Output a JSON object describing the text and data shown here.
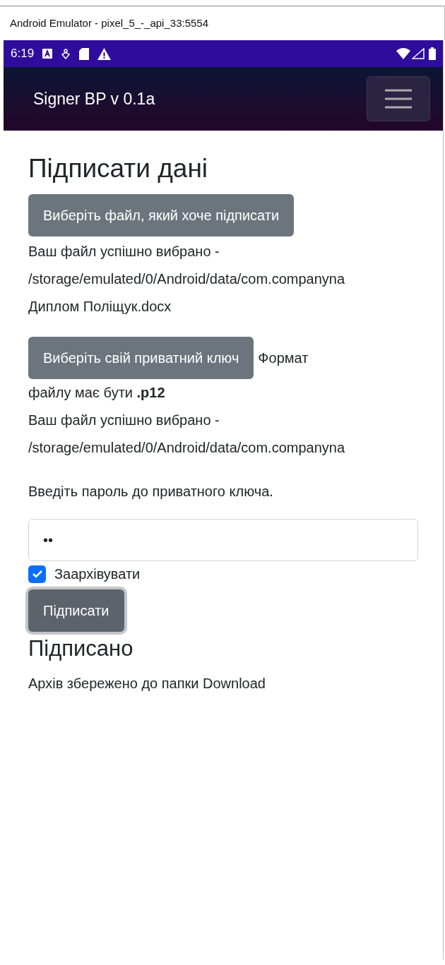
{
  "window": {
    "title": "Android Emulator - pixel_5_-_api_33:5554"
  },
  "status_bar": {
    "time": "6:19"
  },
  "navbar": {
    "brand": "Signer BP v 0.1a"
  },
  "page": {
    "title": "Підписати дані",
    "file_button": {
      "label": "Виберіть файл, який хоче підписати"
    },
    "file_status": [
      "Ваш файл успішно вибрано -",
      "/storage/emulated/0/Android/data/com.companyna",
      "Диплом Поліщук.docx"
    ],
    "key_button": {
      "label": "Виберіть свій приватний ключ"
    },
    "key_format_hint": [
      "Формат",
      "файлу має бути **.p12**"
    ],
    "key_status": [
      "Ваш файл успішно вибрано -",
      "/storage/emulated/0/Android/data/com.companyna"
    ],
    "password_label": "Введіть пароль до приватного ключа.",
    "password_field": {
      "value": "••"
    },
    "archive_checkbox": {
      "label": "Заархівувати",
      "checked": true
    },
    "sign_button": {
      "label": "Підписати",
      "focused": true
    },
    "result_title": "Підписано",
    "result_message": "Архів збережено до папки Download"
  }
}
